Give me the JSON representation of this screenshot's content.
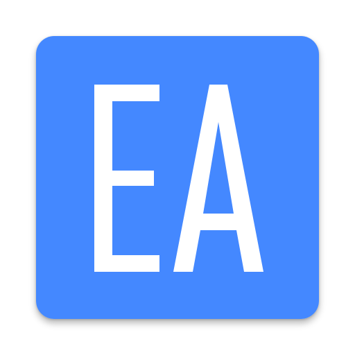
{
  "icon": {
    "letters": "EA",
    "background_color": "#4488FF",
    "letter_color": "#FFFFFF",
    "page_background": "#FFFFFF"
  }
}
